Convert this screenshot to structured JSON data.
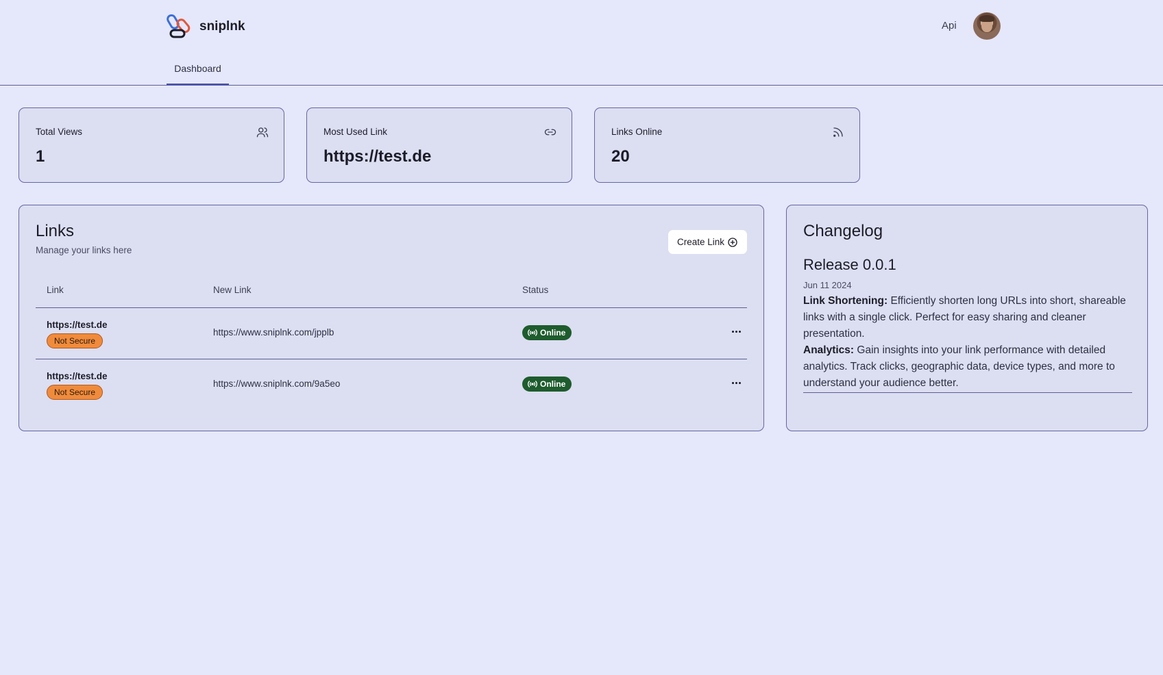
{
  "header": {
    "brand_name": "sniplnk",
    "api_label": "Api",
    "tabs": [
      {
        "label": "Dashboard",
        "active": true
      }
    ]
  },
  "stats": [
    {
      "label": "Total Views",
      "value": "1",
      "icon": "users-icon"
    },
    {
      "label": "Most Used Link",
      "value": "https://test.de",
      "icon": "link-icon"
    },
    {
      "label": "Links Online",
      "value": "20",
      "icon": "rss-icon"
    }
  ],
  "links": {
    "title": "Links",
    "subtitle": "Manage your links here",
    "create_label": "Create Link",
    "columns": [
      "Link",
      "New Link",
      "Status"
    ],
    "rows": [
      {
        "link": "https://test.de",
        "security": "Not Secure",
        "new_link": "https://www.sniplnk.com/jpplb",
        "status": "Online"
      },
      {
        "link": "https://test.de",
        "security": "Not Secure",
        "new_link": "https://www.sniplnk.com/9a5eo",
        "status": "Online"
      }
    ]
  },
  "changelog": {
    "title": "Changelog",
    "release": "Release 0.0.1",
    "date": "Jun 11 2024",
    "items": [
      {
        "heading": "Link Shortening:",
        "text": " Efficiently shorten long URLs into short, shareable links with a single click. Perfect for easy sharing and cleaner presentation."
      },
      {
        "heading": "Analytics:",
        "text": " Gain insights into your link performance with detailed analytics. Track clicks, geographic data, device types, and more to understand your audience better."
      }
    ]
  },
  "colors": {
    "background": "#e5e7fb",
    "card": "#dcdef2",
    "warning": "#f08b3c",
    "online": "#1e5c2d",
    "accent": "#4e55a8"
  }
}
